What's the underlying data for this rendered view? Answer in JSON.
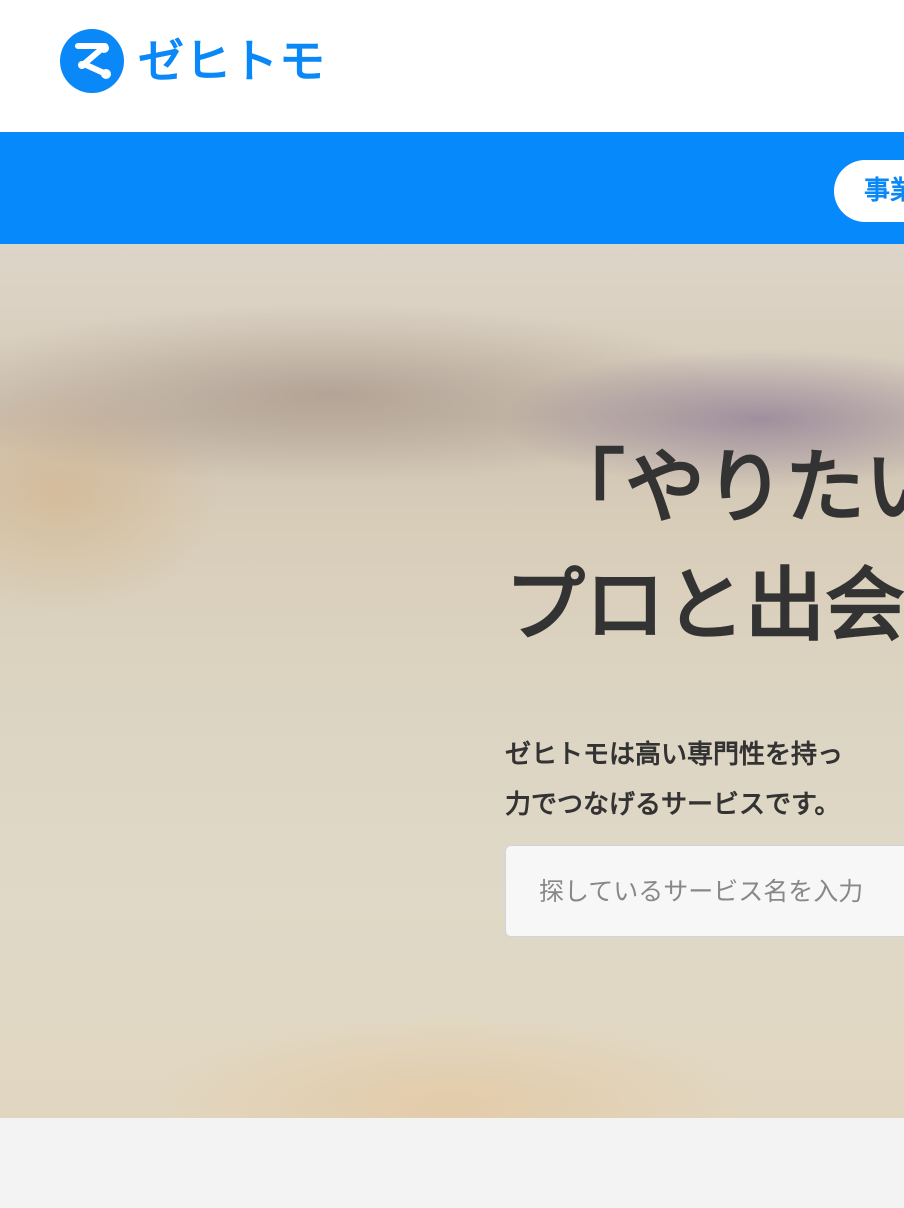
{
  "header": {
    "brand_name": "ゼヒトモ",
    "brand_color": "#0a88f7",
    "logo_icon": "zehitomo-logo-icon"
  },
  "nav": {
    "bar_color": "#0689fa",
    "pill_label": "事業"
  },
  "hero": {
    "title_line1": "「やりたい",
    "title_line2": "プロと出会",
    "desc_line1": "ゼヒトモは高い専門性を持っ",
    "desc_line2": "力でつなげるサービスです。",
    "search": {
      "placeholder": "探しているサービス名を入力",
      "value": ""
    }
  }
}
